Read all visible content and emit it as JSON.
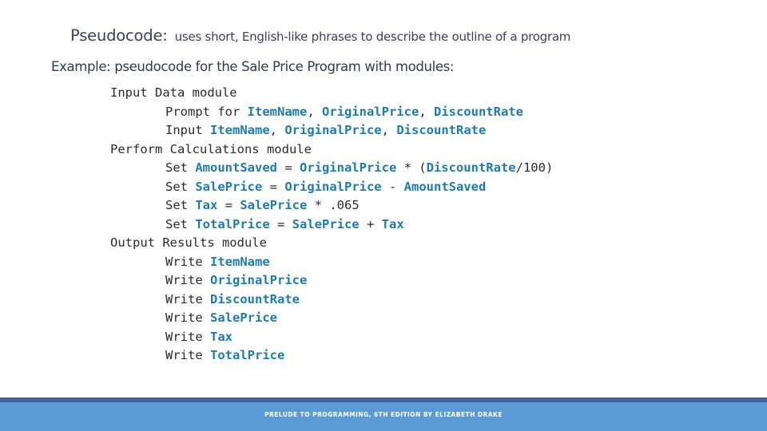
{
  "slide": {
    "background_color": "#ffffff",
    "heading": {
      "term": "Pseudocode:",
      "description": "uses short, English-like phrases to describe the outline of a program"
    },
    "example_label": "Example: pseudocode for the Sale Price Program with modules:",
    "code": {
      "variable_color": "#1b7cb0",
      "keyword_color": "#2b2b2b",
      "lines": [
        {
          "indent": false,
          "segments": [
            {
              "type": "kw",
              "text": "Input Data module"
            }
          ]
        },
        {
          "indent": true,
          "segments": [
            {
              "type": "kw",
              "text": "Prompt for "
            },
            {
              "type": "var",
              "text": "ItemName"
            },
            {
              "type": "op",
              "text": ", "
            },
            {
              "type": "var",
              "text": "OriginalPrice"
            },
            {
              "type": "op",
              "text": ", "
            },
            {
              "type": "var",
              "text": "DiscountRate"
            }
          ]
        },
        {
          "indent": true,
          "segments": [
            {
              "type": "kw",
              "text": "Input "
            },
            {
              "type": "var",
              "text": "ItemName"
            },
            {
              "type": "op",
              "text": ", "
            },
            {
              "type": "var",
              "text": "OriginalPrice"
            },
            {
              "type": "op",
              "text": ", "
            },
            {
              "type": "var",
              "text": "DiscountRate"
            }
          ]
        },
        {
          "indent": false,
          "segments": [
            {
              "type": "kw",
              "text": "Perform Calculations module"
            }
          ]
        },
        {
          "indent": true,
          "segments": [
            {
              "type": "kw",
              "text": "Set "
            },
            {
              "type": "var",
              "text": "AmountSaved"
            },
            {
              "type": "op",
              "text": " = "
            },
            {
              "type": "var",
              "text": "OriginalPrice"
            },
            {
              "type": "op",
              "text": " * ("
            },
            {
              "type": "var",
              "text": "DiscountRate"
            },
            {
              "type": "op",
              "text": "/100)"
            }
          ]
        },
        {
          "indent": true,
          "segments": [
            {
              "type": "kw",
              "text": "Set "
            },
            {
              "type": "var",
              "text": "SalePrice"
            },
            {
              "type": "op",
              "text": " = "
            },
            {
              "type": "var",
              "text": "OriginalPrice"
            },
            {
              "type": "op",
              "text": " - "
            },
            {
              "type": "var",
              "text": "AmountSaved"
            }
          ]
        },
        {
          "indent": true,
          "segments": [
            {
              "type": "kw",
              "text": "Set "
            },
            {
              "type": "var",
              "text": "Tax"
            },
            {
              "type": "op",
              "text": " = "
            },
            {
              "type": "var",
              "text": "SalePrice"
            },
            {
              "type": "op",
              "text": " * .065"
            }
          ]
        },
        {
          "indent": true,
          "segments": [
            {
              "type": "kw",
              "text": "Set "
            },
            {
              "type": "var",
              "text": "TotalPrice"
            },
            {
              "type": "op",
              "text": " = "
            },
            {
              "type": "var",
              "text": "SalePrice"
            },
            {
              "type": "op",
              "text": " + "
            },
            {
              "type": "var",
              "text": "Tax"
            }
          ]
        },
        {
          "indent": false,
          "segments": [
            {
              "type": "kw",
              "text": "Output Results module"
            }
          ]
        },
        {
          "indent": true,
          "segments": [
            {
              "type": "kw",
              "text": "Write "
            },
            {
              "type": "var",
              "text": "ItemName"
            }
          ]
        },
        {
          "indent": true,
          "segments": [
            {
              "type": "kw",
              "text": "Write "
            },
            {
              "type": "var",
              "text": "OriginalPrice"
            }
          ]
        },
        {
          "indent": true,
          "segments": [
            {
              "type": "kw",
              "text": "Write "
            },
            {
              "type": "var",
              "text": "DiscountRate"
            }
          ]
        },
        {
          "indent": true,
          "segments": [
            {
              "type": "kw",
              "text": "Write "
            },
            {
              "type": "var",
              "text": "SalePrice"
            }
          ]
        },
        {
          "indent": true,
          "segments": [
            {
              "type": "kw",
              "text": "Write "
            },
            {
              "type": "var",
              "text": "Tax"
            }
          ]
        },
        {
          "indent": true,
          "segments": [
            {
              "type": "kw",
              "text": "Write "
            },
            {
              "type": "var",
              "text": "TotalPrice"
            }
          ]
        }
      ]
    },
    "footer": {
      "text": "Prelude to Programming, 6th Edition by Elizabeth Drake",
      "band_color": "#5b9bd5",
      "rule_color": "#44619e",
      "text_color": "#ffffff"
    }
  }
}
